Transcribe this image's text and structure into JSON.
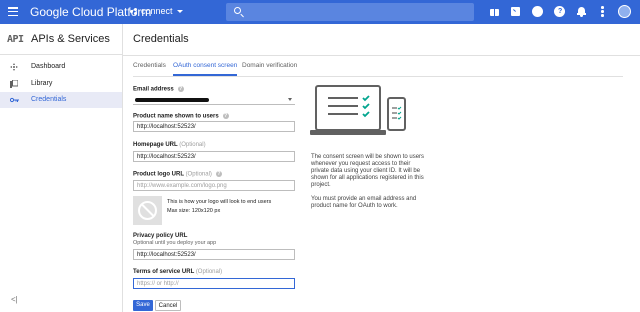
{
  "topbar": {
    "brand": "Google Cloud Platform",
    "project": "connect",
    "icons": [
      "gift-icon",
      "cloud-shell-icon",
      "support-icon",
      "help-icon",
      "notifications-icon",
      "more-vert-icon",
      "avatar"
    ]
  },
  "sidebar": {
    "badge": "API",
    "title": "APIs & Services",
    "items": [
      {
        "label": "Dashboard",
        "icon": "dashboard-icon"
      },
      {
        "label": "Library",
        "icon": "library-icon"
      },
      {
        "label": "Credentials",
        "icon": "key-icon"
      }
    ],
    "collapse": "<|"
  },
  "main": {
    "title": "Credentials",
    "tabs": [
      {
        "label": "Credentials"
      },
      {
        "label": "OAuth consent screen"
      },
      {
        "label": "Domain verification"
      }
    ]
  },
  "form": {
    "email_label": "Email address",
    "product_label": "Product name shown to users",
    "product_value": "http://localhost:52523/",
    "homepage_label": "Homepage URL",
    "optional": "(Optional)",
    "homepage_value": "http://localhost:52523/",
    "logo_label": "Product logo URL",
    "logo_placeholder": "http://www.example.com/logo.png",
    "logo_hint_1": "This is how your logo will look to end users",
    "logo_hint_2": "Max size: 120x120 px",
    "privacy_label": "Privacy policy URL",
    "privacy_sub": "Optional until you deploy your app",
    "privacy_value": "http://localhost:52523/",
    "tos_label": "Terms of service URL",
    "tos_placeholder": "https:// or http://",
    "save": "Save",
    "cancel": "Cancel"
  },
  "info": {
    "p1": "The consent screen will be shown to users whenever you request access to their private data using your client ID. It will be shown for all applications registered in this project.",
    "p2": "You must provide an email address and product name for OAuth to work."
  },
  "colors": {
    "topbar": "#3367d6",
    "accent": "#3367d6",
    "check": "#00a58e"
  }
}
